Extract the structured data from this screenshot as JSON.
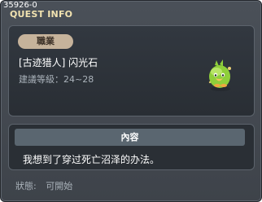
{
  "window": {
    "quest_id": "35926-0",
    "title": "QUEST INFO"
  },
  "quest": {
    "job_badge": "職業",
    "name": "[古迹猎人] 闪光石",
    "recommended_level": "建議等級：24~28",
    "npc_icon": "green-slime-npc-icon"
  },
  "content": {
    "header": "內容",
    "text": "我想到了穿过死亡沼泽的办法。"
  },
  "status": {
    "label": "狀態:",
    "value": "可開始"
  },
  "colors": {
    "title": "#f1e2b0",
    "badge_bg": "#c6b39b",
    "content_header_bg": "#5a6670",
    "window_bg": "#464c54"
  }
}
